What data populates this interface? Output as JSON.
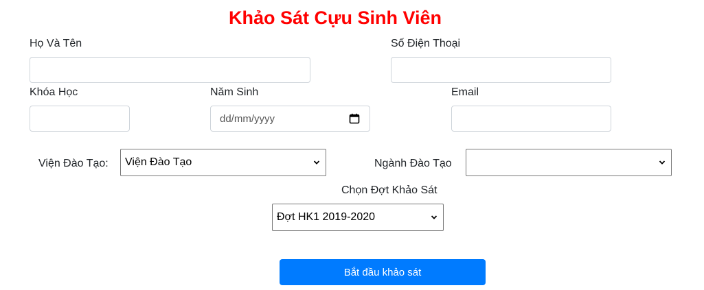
{
  "form": {
    "title": "Khảo Sát Cựu Sinh Viên",
    "ho_va_ten": {
      "label": "Họ Và Tên",
      "value": ""
    },
    "so_dien_thoai": {
      "label": "Số Điện Thoại",
      "value": ""
    },
    "khoa_hoc": {
      "label": "Khóa Học",
      "value": ""
    },
    "nam_sinh": {
      "label": "Năm Sinh",
      "placeholder": "dd/mm/yyyy",
      "icon": "calendar-icon"
    },
    "email": {
      "label": "Email",
      "value": ""
    },
    "vien_dao_tao": {
      "label": "Viện Đào Tạo:",
      "selected": "Viện Đào Tạo"
    },
    "nganh_dao_tao": {
      "label": "Ngành Đào Tạo",
      "selected": ""
    },
    "dot_khao_sat": {
      "label": "Chọn Đợt Khảo Sát",
      "selected": "Đợt HK1 2019-2020"
    },
    "submit_label": "Bắt đầu khảo sát"
  },
  "colors": {
    "title": "#ff0000",
    "button": "#007bff",
    "button_text": "#ffffff",
    "input_border": "#ced4da"
  }
}
